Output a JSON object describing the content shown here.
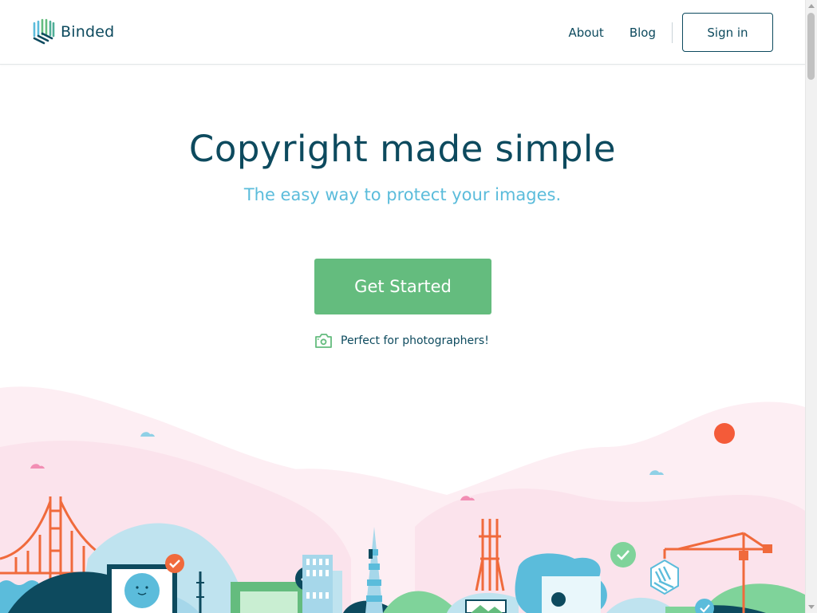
{
  "header": {
    "logo_text": "Binded",
    "nav": {
      "about": "About",
      "blog": "Blog",
      "sign_in": "Sign in"
    }
  },
  "hero": {
    "title": "Copyright made simple",
    "subtitle": "The easy way to protect your images.",
    "cta_label": "Get Started",
    "note": "Perfect for photographers!"
  },
  "colors": {
    "brand_dark": "#0d4a5e",
    "accent_blue": "#5bbcdb",
    "cta_green": "#64bc7e",
    "orange": "#f06a3c",
    "pink": "#fde4ee"
  },
  "icons": {
    "logo": "binded-logo-icon",
    "camera": "camera-icon"
  }
}
